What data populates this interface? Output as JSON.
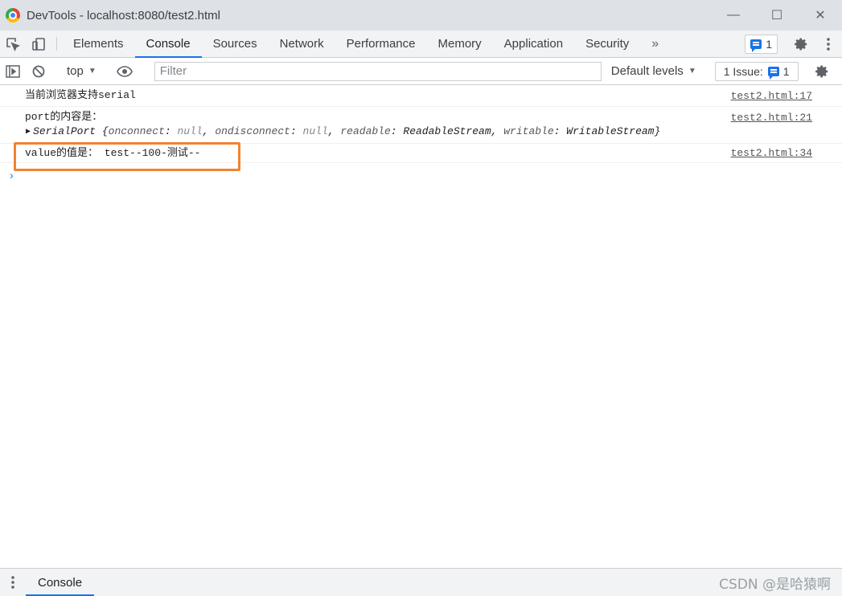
{
  "window": {
    "title": "DevTools - localhost:8080/test2.html",
    "minimize": "—",
    "maximize": "☐",
    "close": "✕"
  },
  "tabs": [
    {
      "label": "Elements"
    },
    {
      "label": "Console"
    },
    {
      "label": "Sources"
    },
    {
      "label": "Network"
    },
    {
      "label": "Performance"
    },
    {
      "label": "Memory"
    },
    {
      "label": "Application"
    },
    {
      "label": "Security"
    }
  ],
  "tabbar": {
    "more": "»",
    "messages_count": "1"
  },
  "toolbar": {
    "context": "top",
    "filter_placeholder": "Filter",
    "levels": "Default levels",
    "issues_label": "1 Issue:",
    "issues_count": "1"
  },
  "console": {
    "messages": [
      {
        "text": "当前浏览器支持serial",
        "source": "test2.html:17"
      },
      {
        "text": "port的内容是：",
        "source": "test2.html:21"
      },
      {
        "text": "value的值是： test--100-测试--",
        "source": "test2.html:34"
      }
    ],
    "object": {
      "class": "SerialPort",
      "props": [
        {
          "key": "onconnect",
          "value": "null"
        },
        {
          "key": "ondisconnect",
          "value": "null"
        },
        {
          "key": "readable",
          "value": "ReadableStream"
        },
        {
          "key": "writable",
          "value": "WritableStream"
        }
      ]
    },
    "prompt": "›"
  },
  "drawer": {
    "tab": "Console",
    "watermark": "CSDN @是哈猿啊"
  },
  "colors": {
    "accent": "#1a73e8",
    "highlight": "#ef8433"
  }
}
